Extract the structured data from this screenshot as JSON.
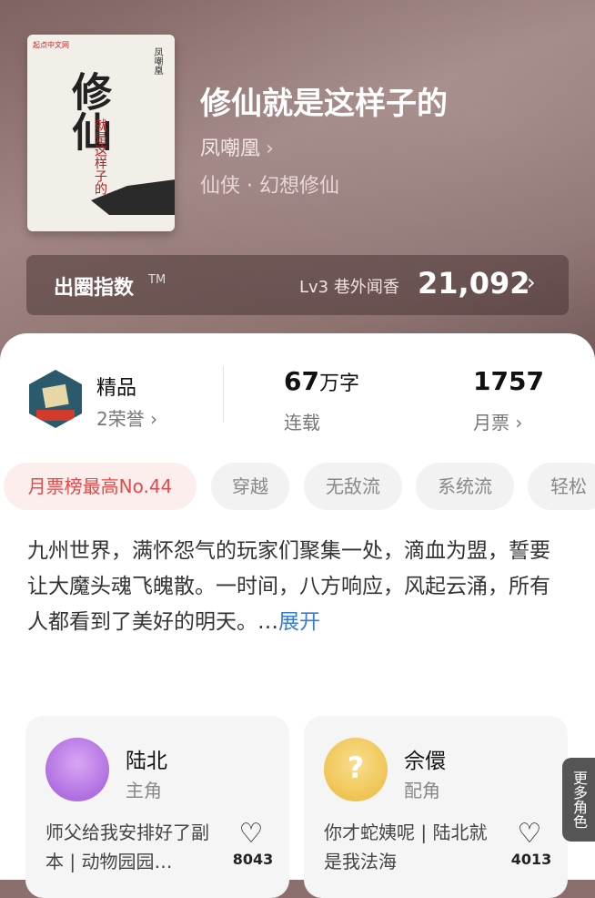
{
  "book": {
    "title": "修仙就是这样子的",
    "author": "凤嘲凰",
    "author_chevron": "›",
    "genre": "仙侠 · 幻想修仙",
    "cover": {
      "brand": "起点中文网",
      "title_main": "修仙",
      "title_sub": "就是这样子的",
      "author_vertical": "凤嘲凰"
    }
  },
  "index_bar": {
    "label": "出圈指数",
    "tm": "TM",
    "rank": "Lv3 巷外闻香",
    "value": "21,092",
    "chevron": "›"
  },
  "stats": {
    "quality": "精品",
    "honor": "2荣誉 ›",
    "words_num": "67",
    "words_unit": "万字",
    "status": "连载",
    "tickets": "1757",
    "tickets_label": "月票 ›"
  },
  "tags": [
    "月票榜最高No.44",
    "穿越",
    "无敌流",
    "系统流",
    "轻松"
  ],
  "description": {
    "text": "九州世界，满怀怨气的玩家们聚集一处，滴血为盟，誓要让大魔头魂飞魄散。一时间，八方响应，风起云涌，所有人都看到了美好的明天。…",
    "more": "展开"
  },
  "characters": [
    {
      "name": "陆北",
      "role": "主角",
      "quote": "师父给我安排好了副本 | 动物园园…",
      "likes": "8043"
    },
    {
      "name": "佘儇",
      "role": "配角",
      "quote": "你才蛇姨呢 | 陆北就是我法海",
      "likes": "4013"
    }
  ],
  "more_roles": "更多角色",
  "colors": {
    "accent": "#e04b4b",
    "link": "#3a7bd5"
  }
}
